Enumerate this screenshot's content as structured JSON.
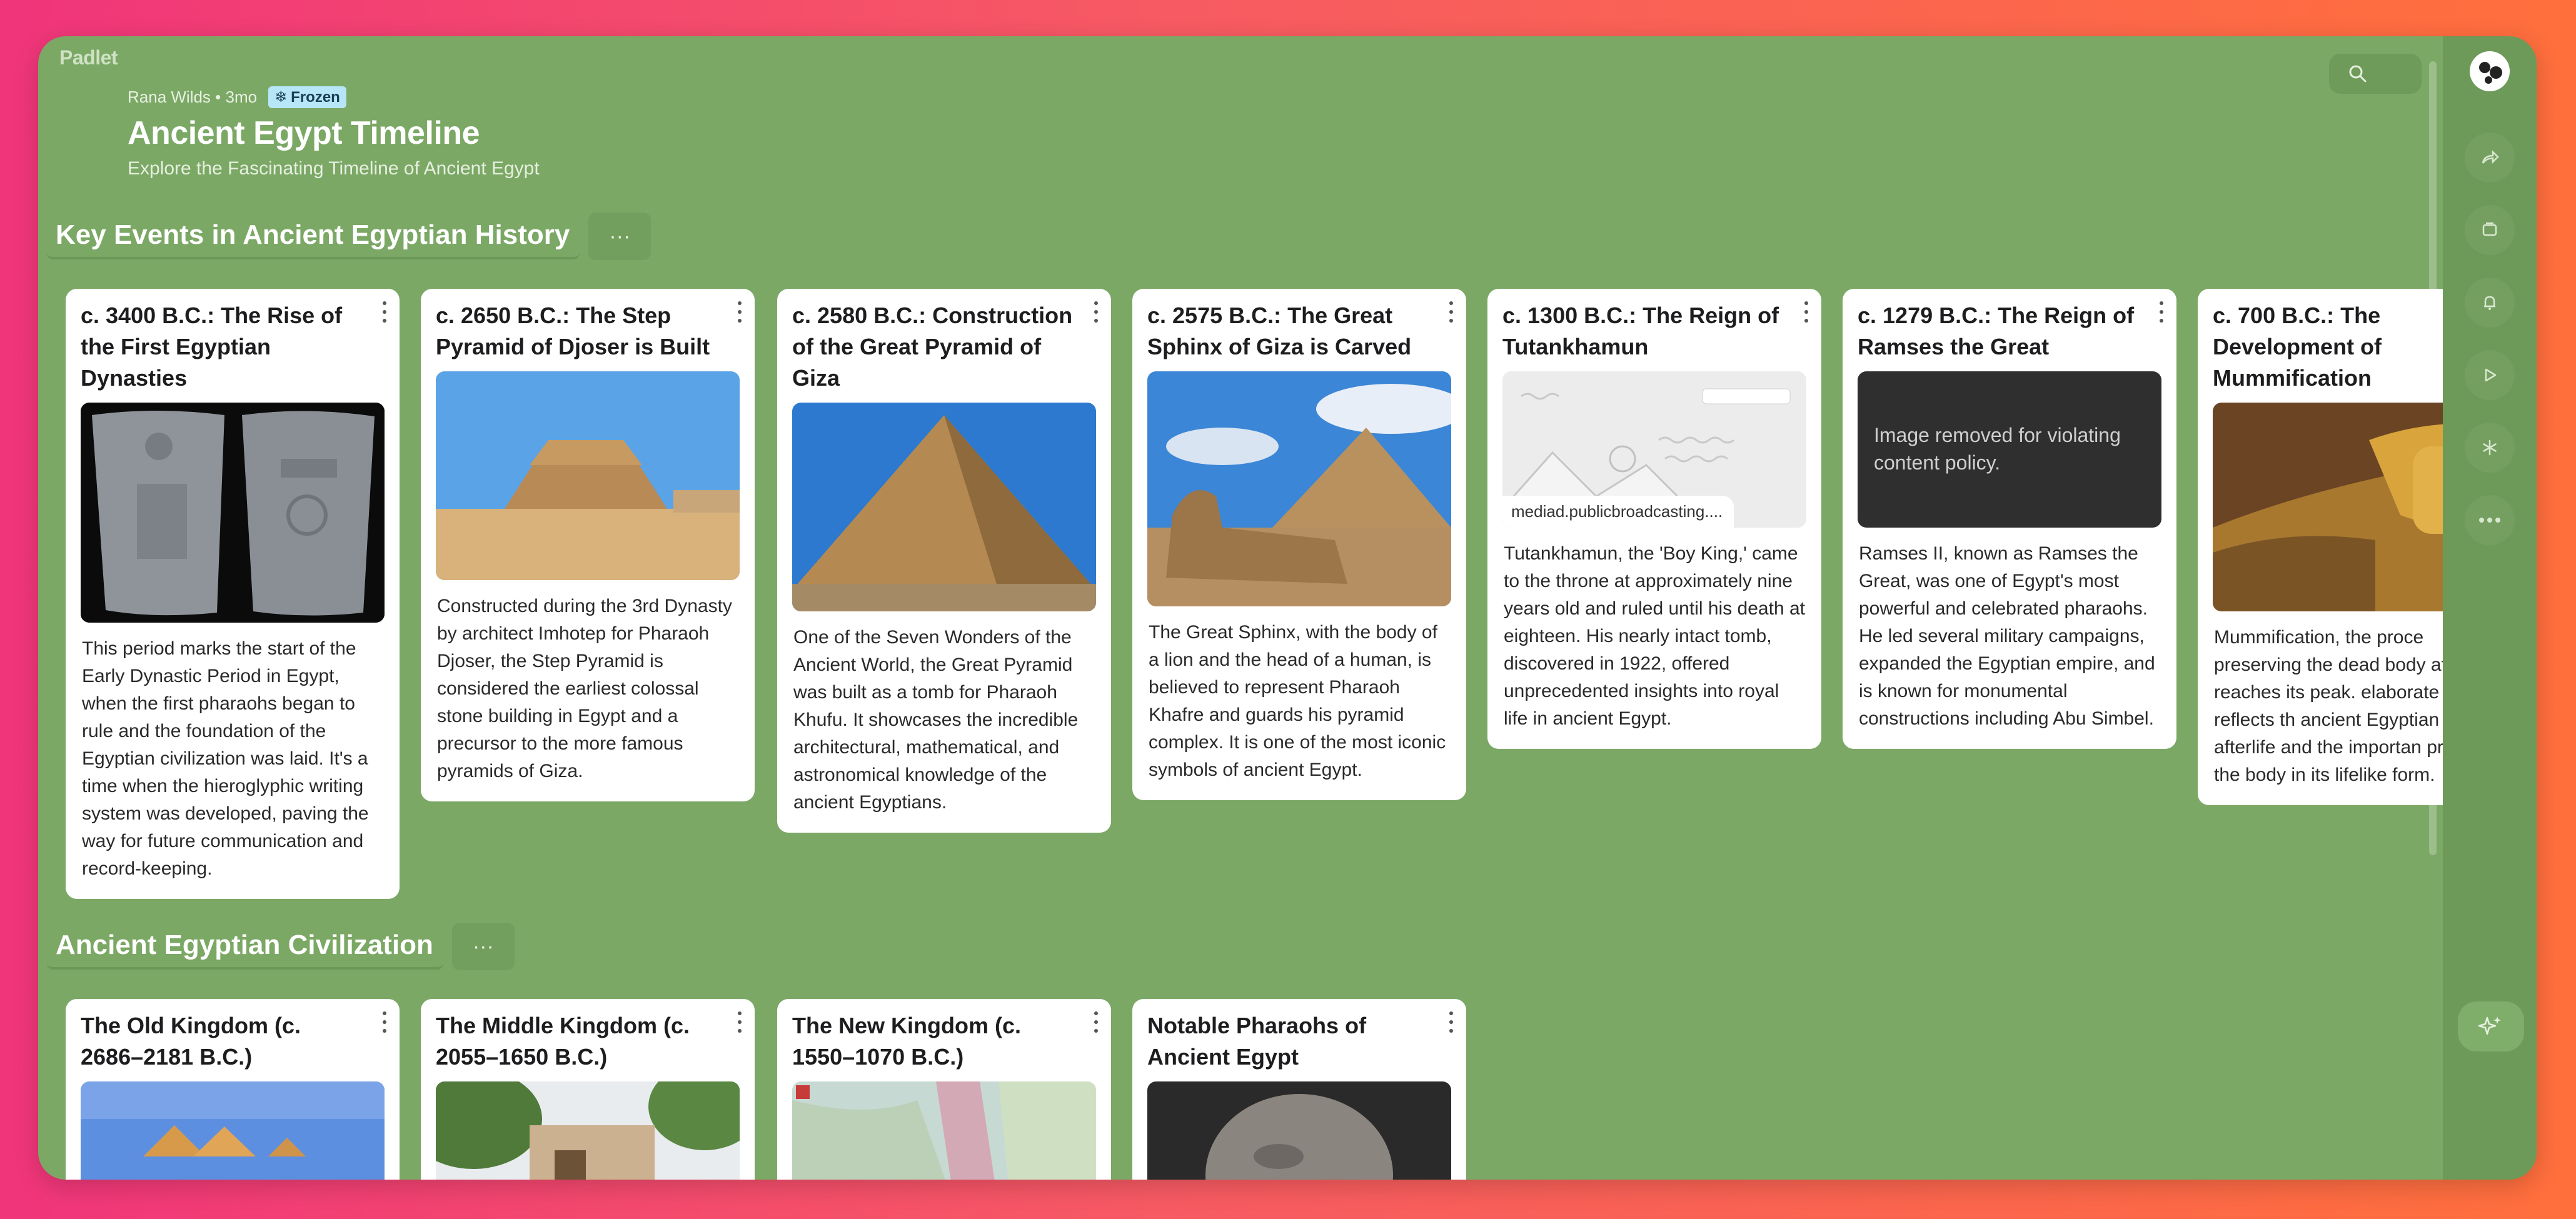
{
  "app": {
    "logo": "Padlet"
  },
  "board": {
    "author_line": "Rana Wilds • 3mo",
    "badge": "Frozen",
    "title": "Ancient Egypt Timeline",
    "subtitle": "Explore the Fascinating Timeline of Ancient Egypt"
  },
  "sections": [
    {
      "title": "Key Events in Ancient Egyptian History",
      "more": "···",
      "cards": [
        {
          "title": "c. 3400 B.C.: The Rise of the First Egyptian Dynasties",
          "image": "narmer-palette-photo",
          "body": "This period marks the start of the Early Dynastic Period in Egypt, when the first pharaohs began to rule and the foundation of the Egyptian civilization was laid. It's a time when the hieroglyphic writing system was developed, paving the way for future communication and record-keeping."
        },
        {
          "title": "c. 2650 B.C.: The Step Pyramid of Djoser is Built",
          "image": "step-pyramid-photo",
          "body": "Constructed during the 3rd Dynasty by architect Imhotep for Pharaoh Djoser, the Step Pyramid is considered the earliest colossal stone building in Egypt and a precursor to the more famous pyramids of Giza."
        },
        {
          "title": "c. 2580 B.C.: Construction of the Great Pyramid of Giza",
          "image": "great-pyramid-photo",
          "body": "One of the Seven Wonders of the Ancient World, the Great Pyramid was built as a tomb for Pharaoh Khufu. It showcases the incredible architectural, mathematical, and astronomical knowledge of the ancient Egyptians."
        },
        {
          "title": "c. 2575 B.C.: The Great Sphinx of Giza is Carved",
          "image": "sphinx-photo",
          "body": "The Great Sphinx, with the body of a lion and the head of a human, is believed to represent Pharaoh Khafre and guards his pyramid complex. It is one of the most iconic symbols of ancient Egypt."
        },
        {
          "title": "c. 1300 B.C.: The Reign of Tutankhamun",
          "link_label": "mediad.publicbroadcasting....",
          "body": "Tutankhamun, the 'Boy King,' came to the throne at approximately nine years old and ruled until his death at eighteen. His nearly intact tomb, discovered in 1922, offered unprecedented insights into royal life in ancient Egypt."
        },
        {
          "title": "c. 1279 B.C.: The Reign of Ramses the Great",
          "removed_text": "Image removed for violating content policy.",
          "body": "Ramses II, known as Ramses the Great, was one of Egypt's most powerful and celebrated pharaohs. He led several military campaigns, expanded the Egyptian empire, and is known for monumental constructions including Abu Simbel."
        },
        {
          "title": "c. 700 B.C.: The Development of Mummification",
          "image": "sarcophagus-photo",
          "body": "Mummification, the proce preserving the dead body afterlife, reaches its peak. elaborate ritual reflects th ancient Egyptian belief in afterlife and the importan preserving the body in its lifelike form."
        }
      ]
    },
    {
      "title": "Ancient Egyptian Civilization",
      "more": "···",
      "cards": [
        {
          "title": "The Old Kingdom (c. 2686–2181 B.C.)",
          "image": "giza-pyramids-sunset-photo"
        },
        {
          "title": "The Middle Kingdom (c. 2055–1650 B.C.)",
          "image": "temple-building-photo"
        },
        {
          "title": "The New Kingdom (c. 1550–1070 B.C.)",
          "image": "new-kingdom-map"
        },
        {
          "title": "Notable Pharaohs of Ancient Egypt",
          "image": "mummy-head-photo"
        }
      ]
    }
  ]
}
